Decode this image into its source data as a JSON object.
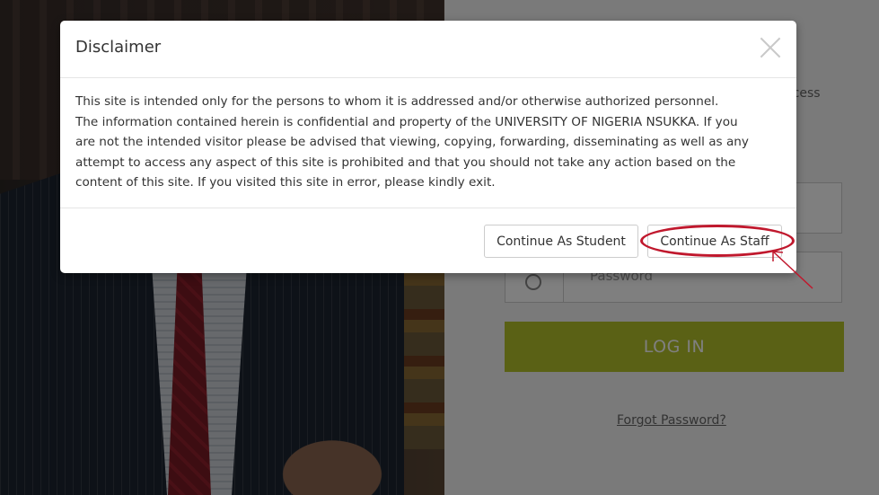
{
  "modal": {
    "title": "Disclaimer",
    "close_icon": "close-icon",
    "body_lines": [
      "This site is intended only for the persons to whom it is addressed and/or otherwise authorized personnel.",
      "The information contained herein is confidential and property of the UNIVERSITY OF NIGERIA NSUKKA. If you",
      "are not the intended visitor please be advised that viewing, copying, forwarding, disseminating as well as any",
      "attempt to access any aspect of this site is prohibited and that you should not take any action based on the",
      "content of this site. If you visited this site in error, please kindly exit."
    ],
    "student_button": "Continue As Student",
    "staff_button": "Continue As Staff"
  },
  "login": {
    "subtitle": "ccess",
    "password_placeholder": "Password",
    "login_button": "LOG IN",
    "forgot_link": "Forgot Password?"
  },
  "colors": {
    "login_button": "#b5c22b",
    "annotation": "#c0182d",
    "backdrop": "rgba(0,0,0,0.5)"
  }
}
